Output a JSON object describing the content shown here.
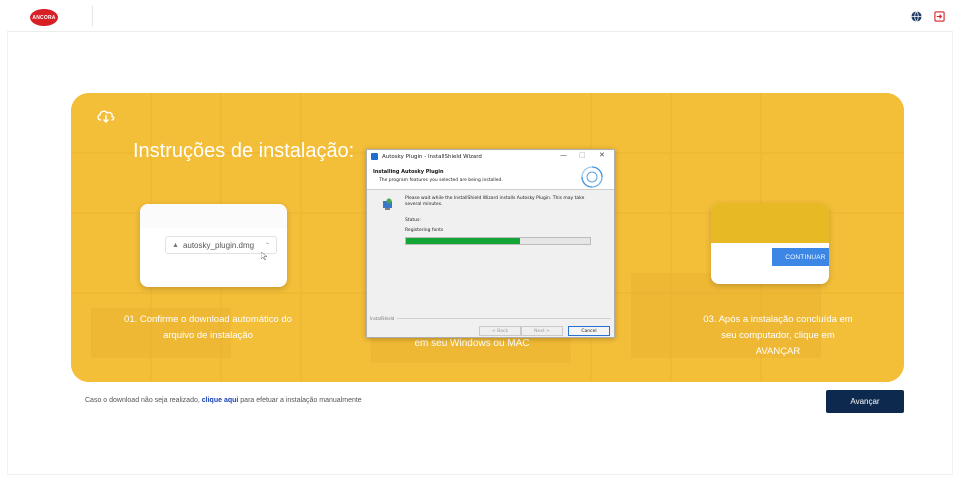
{
  "header": {
    "logo_text": "ANCORA"
  },
  "banner": {
    "title": "Instruções de instalação:",
    "step1": {
      "file_name": "autosky_plugin.dmg",
      "text": "01. Confirme o download automático do arquivo de instalação"
    },
    "step2": {
      "text": "em seu Windows ou MAC"
    },
    "step3": {
      "button_label": "CONTINUAR",
      "text": "03. Após a instalação concluída em seu computador, clique em AVANÇAR"
    }
  },
  "dialog": {
    "title": "Autosky Plugin - InstallShield Wizard",
    "heading": "Installing Autosky Plugin",
    "subheading": "The program features you selected are being installed.",
    "message": "Please wait while the InstallShield Wizard installs Autosky Plugin. This may take several minutes.",
    "status_label": "Status:",
    "status_value": "Registering fonts",
    "progress_fraction": 0.62,
    "footer_label": "InstallShield",
    "back_label": "< Back",
    "next_label": "Next >",
    "cancel_label": "Cancel",
    "min_glyph": "—",
    "max_glyph": "□",
    "close_glyph": "✕"
  },
  "footer": {
    "note_prefix": "Caso o download não seja realizado,",
    "note_link": "clique aqui",
    "note_suffix": "para efetuar a instalação manualmente",
    "advance_label": "Avançar"
  },
  "colors": {
    "brand_red": "#d81f26",
    "banner_yellow": "#f4c13a",
    "primary_navy": "#0d2a4e",
    "link_blue": "#1a43b8",
    "progress_green": "#13a636"
  }
}
